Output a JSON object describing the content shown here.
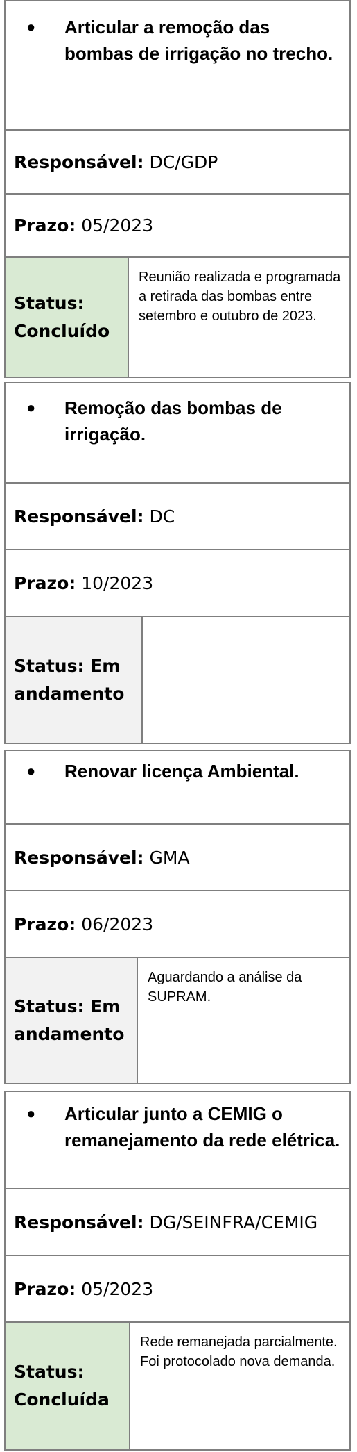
{
  "bullet": "●",
  "responsavel_label": "Responsável:",
  "prazo_label": "Prazo:",
  "status_colors": {
    "concluido": "#d9ead3",
    "em_andamento": "#f2f2f2"
  },
  "cards": [
    {
      "title": "Articular a remoção das bombas de irrigação no trecho.",
      "responsavel": "DC/GDP",
      "prazo": "05/2023",
      "status_line1": "Status:",
      "status_line2": "Concluído",
      "note": "Reunião realizada e programada a retirada das bombas entre setembro e outubro de 2023."
    },
    {
      "title": "Remoção das bombas de irrigação.",
      "responsavel": "DC",
      "prazo": "10/2023",
      "status_line1": "Status: Em",
      "status_line2": "andamento",
      "note": ""
    },
    {
      "title": "Renovar licença Ambiental.",
      "responsavel": "GMA",
      "prazo": "06/2023",
      "status_line1": "Status: Em",
      "status_line2": "andamento",
      "note": "Aguardando a análise da SUPRAM."
    },
    {
      "title": "Articular junto a CEMIG o remanejamento da rede elétrica.",
      "responsavel": "DG/SEINFRA/CEMIG",
      "prazo": "05/2023",
      "status_line1": "Status:",
      "status_line2": "Concluída",
      "note": "Rede remanejada parcialmente. Foi protocolado nova demanda."
    }
  ]
}
